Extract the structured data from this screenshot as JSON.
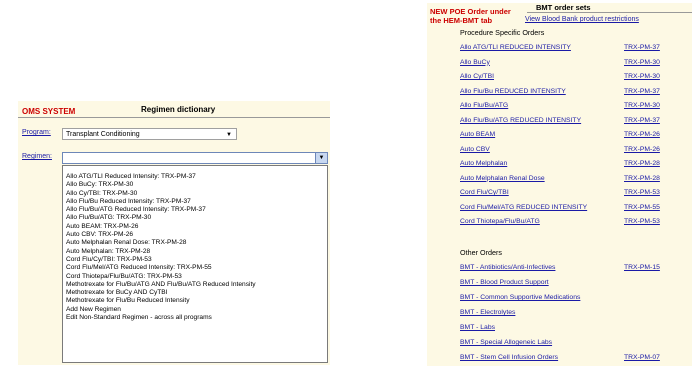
{
  "oms": {
    "system_label": "OMS SYSTEM",
    "title": "Regimen dictionary",
    "program_label": "Program:",
    "program_value": "Transplant Conditioning",
    "regimen_label": "Regimen:",
    "regimen_value": "",
    "regimen_options": [
      "Allo ATG/TLI Reduced Intensity: TRX-PM-37",
      "Allo BuCy: TRX-PM-30",
      "Allo Cy/TBI: TRX-PM-30",
      "Allo Flu/Bu Reduced Intensity: TRX-PM-37",
      "Allo Flu/Bu/ATG Reduced Intensity: TRX-PM-37",
      "Allo Flu/Bu/ATG: TRX-PM-30",
      "Auto BEAM: TRX-PM-26",
      "Auto CBV: TRX-PM-26",
      "Auto Melphalan Renal Dose: TRX-PM-28",
      "Auto Melphalan: TRX-PM-28",
      "Cord Flu/Cy/TBI: TRX-PM-53",
      "Cord Flu/Mel/ATG Reduced Intensity: TRX-PM-55",
      "Cord Thiotepa/Flu/Bu/ATG: TRX-PM-53",
      "Methotrexate for Flu/Bu/ATG AND Flu/Bu/ATG Reduced Intensity",
      "Methotrexate for BuCy AND CyTBI",
      "Methotrexate for Flu/Bu Reduced Intensity",
      "Add New Regimen",
      "Edit Non-Standard Regimen - across all programs"
    ]
  },
  "bmt": {
    "new_poe_note": "NEW POE Order under the HEM-BMT tab",
    "title": "BMT order sets",
    "blood_bank_link": "View Blood Bank product restrictions",
    "procedure_heading": "Procedure Specific Orders",
    "procedure_orders": [
      {
        "name": "Allo ATG/TLI REDUCED INTENSITY",
        "code": "TRX-PM-37"
      },
      {
        "name": "Allo BuCy",
        "code": "TRX-PM-30"
      },
      {
        "name": "Allo Cy/TBI",
        "code": "TRX-PM-30"
      },
      {
        "name": "Allo Flu/Bu REDUCED INTENSITY",
        "code": "TRX-PM-37"
      },
      {
        "name": "Allo Flu/Bu/ATG",
        "code": "TRX-PM-30"
      },
      {
        "name": "Allo Flu/Bu/ATG REDUCED INTENSITY",
        "code": "TRX-PM-37"
      },
      {
        "name": "Auto BEAM",
        "code": "TRX-PM-26"
      },
      {
        "name": "Auto CBV",
        "code": "TRX-PM-26"
      },
      {
        "name": "Auto Melphalan",
        "code": "TRX-PM-28"
      },
      {
        "name": "Auto Melphalan Renal Dose",
        "code": "TRX-PM-28"
      },
      {
        "name": "Cord Flu/Cy/TBI",
        "code": "TRX-PM-53"
      },
      {
        "name": "Cord Flu/Mel/ATG REDUCED INTENSITY",
        "code": "TRX-PM-55"
      },
      {
        "name": "Cord Thiotepa/Flu/Bu/ATG",
        "code": "TRX-PM-53"
      }
    ],
    "other_heading": "Other Orders",
    "other_orders": [
      {
        "name": "BMT - Antibiotics/Anti-Infectives",
        "code": "TRX-PM-15"
      },
      {
        "name": "BMT - Blood Product Support",
        "code": ""
      },
      {
        "name": "BMT - Common Supportive Medications",
        "code": ""
      },
      {
        "name": "BMT - Electrolytes",
        "code": ""
      },
      {
        "name": "BMT - Labs",
        "code": ""
      },
      {
        "name": "BMT - Special Allogeneic Labs",
        "code": ""
      },
      {
        "name": "BMT - Stem Cell Infusion Orders",
        "code": "TRX-PM-07"
      }
    ]
  }
}
